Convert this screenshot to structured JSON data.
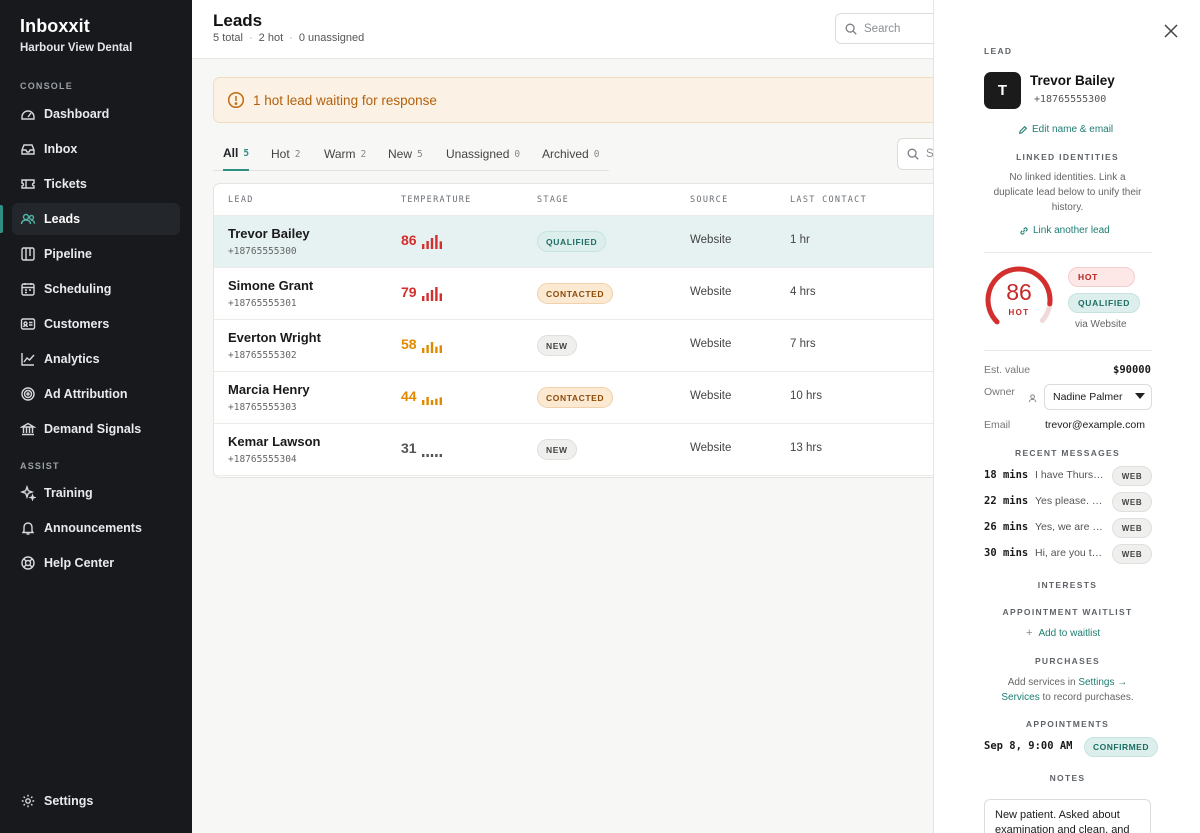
{
  "app": {
    "name": "Inboxxit",
    "workspace": "Harbour View Dental"
  },
  "sidebar": {
    "console_label": "CONSOLE",
    "assist_label": "ASSIST",
    "items": [
      {
        "label": "Dashboard",
        "icon": "dashboard-icon"
      },
      {
        "label": "Inbox",
        "icon": "inbox-icon"
      },
      {
        "label": "Tickets",
        "icon": "ticket-icon"
      },
      {
        "label": "Leads",
        "icon": "users-icon",
        "active": true
      },
      {
        "label": "Pipeline",
        "icon": "pipeline-icon"
      },
      {
        "label": "Scheduling",
        "icon": "calendar-icon"
      },
      {
        "label": "Customers",
        "icon": "id-card-icon"
      },
      {
        "label": "Analytics",
        "icon": "chart-line-icon"
      },
      {
        "label": "Ad Attribution",
        "icon": "target-icon"
      },
      {
        "label": "Demand Signals",
        "icon": "bank-icon"
      }
    ],
    "assist_items": [
      {
        "label": "Training",
        "icon": "sparkle-icon"
      },
      {
        "label": "Announcements",
        "icon": "bell-icon"
      },
      {
        "label": "Help Center",
        "icon": "lifebuoy-icon"
      }
    ],
    "settings_label": "Settings"
  },
  "header": {
    "title": "Leads",
    "stats": {
      "total_num": "5",
      "total_label": "total",
      "hot_num": "2",
      "hot_label": "hot",
      "unassigned_num": "0",
      "unassigned_label": "unassigned"
    },
    "search_placeholder": "Search"
  },
  "alert": {
    "text": "1 hot lead waiting for response"
  },
  "tabs": [
    {
      "label": "All",
      "count": "5",
      "active": true
    },
    {
      "label": "Hot",
      "count": "2"
    },
    {
      "label": "Warm",
      "count": "2"
    },
    {
      "label": "New",
      "count": "5"
    },
    {
      "label": "Unassigned",
      "count": "0"
    },
    {
      "label": "Archived",
      "count": "0"
    }
  ],
  "list_search_placeholder": "Search",
  "table": {
    "columns": [
      "LEAD",
      "TEMPERATURE",
      "STAGE",
      "SOURCE",
      "LAST CONTACT"
    ],
    "rows": [
      {
        "name": "Trevor Bailey",
        "phone": "+18765555300",
        "temperature": "86",
        "stage": "QUALIFIED",
        "source": "Website",
        "last_contact": "1 hr"
      },
      {
        "name": "Simone Grant",
        "phone": "+18765555301",
        "temperature": "79",
        "stage": "CONTACTED",
        "source": "Website",
        "last_contact": "4 hrs"
      },
      {
        "name": "Everton Wright",
        "phone": "+18765555302",
        "temperature": "58",
        "stage": "NEW",
        "source": "Website",
        "last_contact": "7 hrs"
      },
      {
        "name": "Marcia Henry",
        "phone": "+18765555303",
        "temperature": "44",
        "stage": "CONTACTED",
        "source": "Website",
        "last_contact": "10 hrs"
      },
      {
        "name": "Kemar Lawson",
        "phone": "+18765555304",
        "temperature": "31",
        "stage": "NEW",
        "source": "Website",
        "last_contact": "13 hrs"
      }
    ]
  },
  "detail": {
    "section_lead": "LEAD",
    "avatar_initial": "T",
    "name": "Trevor Bailey",
    "phone": "+18765555300",
    "edit_link": "Edit name & email",
    "linked_identities_label": "LINKED IDENTITIES",
    "linked_identities_text_1": "No linked identities. Link a",
    "linked_identities_text_2": "duplicate lead below to unify their",
    "linked_identities_text_3": "history.",
    "link_another": "Link another lead",
    "score": "86",
    "score_fraction": 0.86,
    "score_label": "HOT",
    "badge_hot": "HOT",
    "badge_stage": "QUALIFIED",
    "via": "via Website",
    "est_value_label": "Est. value",
    "est_value": "$90000",
    "owner_label": "Owner",
    "owner_value": "Nadine Palmer",
    "email_label": "Email",
    "email_value": "trevor@example.com",
    "recent_messages_label": "RECENT MESSAGES",
    "messages": [
      {
        "time": "18 mins",
        "text": "I have Thurs…",
        "channel": "WEB"
      },
      {
        "time": "22 mins",
        "text": "Yes please. …",
        "channel": "WEB"
      },
      {
        "time": "26 mins",
        "text": "Yes, we are …",
        "channel": "WEB"
      },
      {
        "time": "30 mins",
        "text": "Hi, are you t…",
        "channel": "WEB"
      }
    ],
    "interests_label": "INTERESTS",
    "waitlist_label": "APPOINTMENT WAITLIST",
    "add_waitlist": "Add to waitlist",
    "purchases_label": "PURCHASES",
    "purchases_text_pre": "Add services in",
    "purchases_link_settings": "Settings →",
    "purchases_link_services": "Services",
    "purchases_text_post": "to record purchases.",
    "appointments_label": "APPOINTMENTS",
    "appointment_time": "Sep 8, 9:00 AM",
    "appointment_status": "CONFIRMED",
    "notes_label": "NOTES",
    "notes_text": "New patient. Asked about examination and clean, and"
  },
  "colors": {
    "accent": "#2f8f83",
    "hot": "#d32f2f",
    "warm": "#e08a00",
    "sidebar_bg": "#17191c"
  }
}
